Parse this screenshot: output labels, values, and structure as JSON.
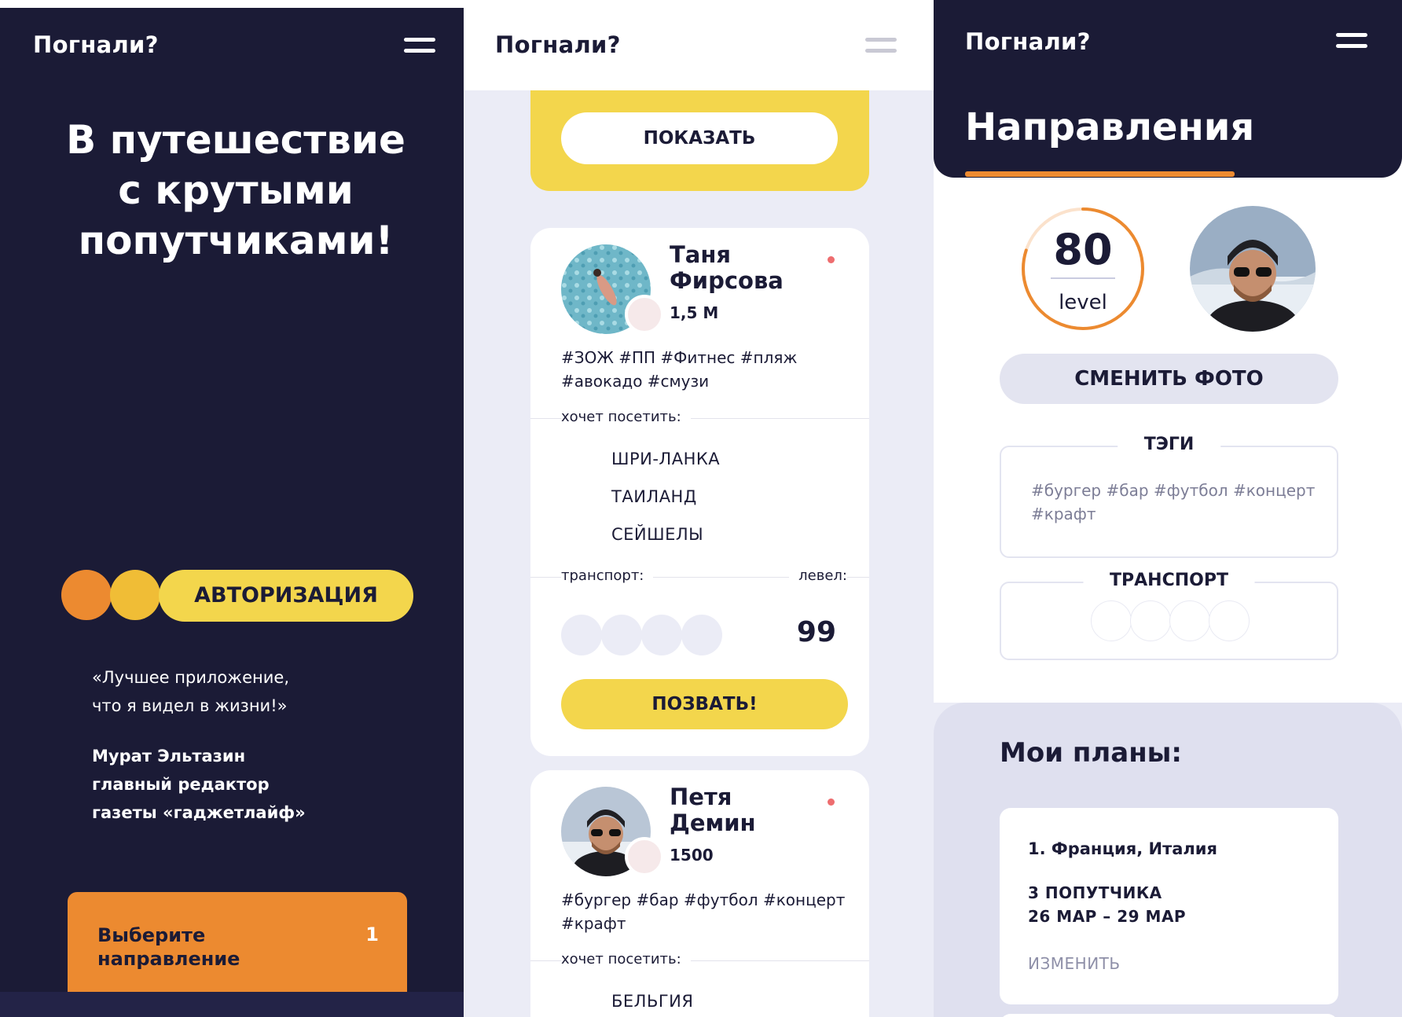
{
  "logo": "Погнали?",
  "colors": {
    "navy": "#1b1b36",
    "yellow": "#f3d64c",
    "orange": "#ec8a30",
    "lavender": "#ebecf6",
    "online_red": "#ee6d6f"
  },
  "icons": [
    "burger-menu-icon"
  ],
  "panel1": {
    "hero_title": "В путешествие\nс крутыми\nпопутчиками!",
    "auth_button": "АВТОРИЗАЦИЯ",
    "quote": "«Лучшее приложение,\nчто я видел в жизни!»",
    "author": "Мурат Эльтазин\nглавный редактор\nгазеты «гаджетлайф»",
    "step": {
      "label": "Выберите\nнаправление",
      "number": "1"
    }
  },
  "panel2": {
    "show_button": "ПОКАЗАТЬ",
    "cards": [
      {
        "name": "Таня\nФирсова",
        "followers": "1,5 М",
        "tags": "#ЗОЖ #ПП #Фитнес #пляж #авокадо #смузи",
        "wants_label": "хочет посетить:",
        "countries": [
          "ШРИ-ЛАНКА",
          "ТАИЛАНД",
          "СЕЙШЕЛЫ"
        ],
        "transport_label": "транспорт:",
        "level_label": "левел:",
        "level": "99",
        "invite_button": "ПОЗВАТЬ!"
      },
      {
        "name": "Петя\nДемин",
        "followers": "1500",
        "tags": "#бургер #бар #футбол #концерт #крафт",
        "wants_label": "хочет посетить:",
        "countries": [
          "БЕЛЬГИЯ"
        ]
      }
    ]
  },
  "panel3": {
    "title": "Направления",
    "level_value": "80",
    "level_word": "level",
    "level_fraction": 0.8,
    "change_photo_button": "СМЕНИТЬ ФОТО",
    "tags_legend": "ТЭГИ",
    "tags": "#бургер #бар #футбол #концерт #крафт",
    "transport_legend": "ТРАНСПОРТ",
    "plans_title": "Мои планы:",
    "plan": {
      "name": "1. Франция, Италия",
      "people": "3 ПОПУТЧИКА",
      "dates": "26 МАР – 29 МАР",
      "edit": "ИЗМЕНИТЬ"
    }
  }
}
